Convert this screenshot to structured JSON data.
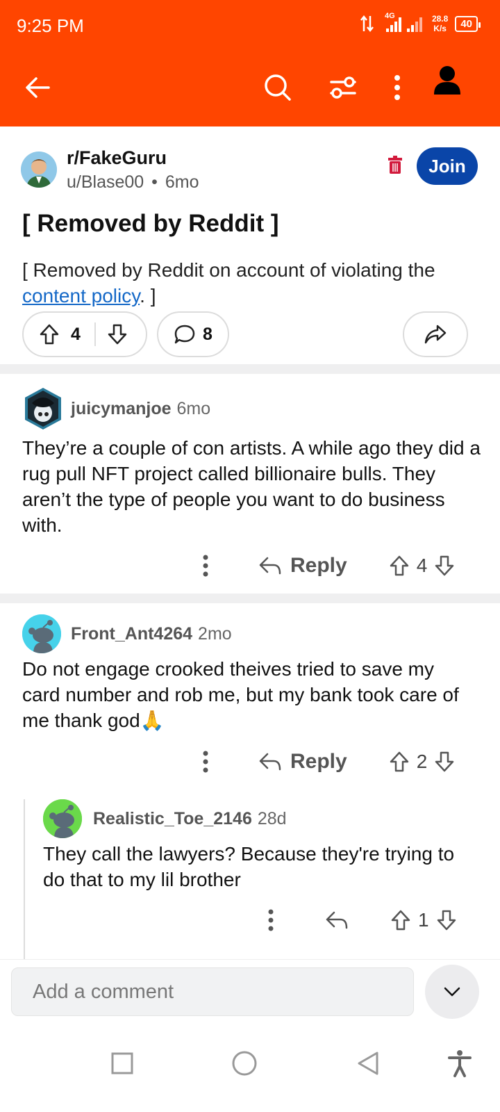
{
  "status_bar": {
    "time": "9:25 PM",
    "network": "4G",
    "speed_value": "28.8",
    "speed_unit": "K/s",
    "battery": "40"
  },
  "toolbar": {
    "back_icon": "arrow-left-icon",
    "search_icon": "search-icon",
    "filter_icon": "sliders-icon",
    "more_icon": "more-vertical-icon",
    "profile_icon": "person-icon"
  },
  "post": {
    "subreddit": "r/FakeGuru",
    "author": "u/Blase00",
    "separator": "•",
    "age": "6mo",
    "join_label": "Join",
    "title": "[ Removed by Reddit ]",
    "body_before": "[ Removed by Reddit on account of violating the ",
    "body_link": "content policy",
    "body_after": ". ]",
    "upvotes": "4",
    "comments": "8"
  },
  "comments": [
    {
      "author": "juicymanjoe",
      "age": "6mo",
      "text": "They’re a couple of con artists. A while ago they did a rug pull NFT project called billionaire bulls. They aren’t the type of people you want to do business with.",
      "reply_label": "Reply",
      "votes": "4"
    },
    {
      "author": "Front_Ant4264",
      "age": "2mo",
      "text": "Do not engage crooked theives tried to save my card number and rob me, but my bank took care of me thank god🙏",
      "reply_label": "Reply",
      "votes": "2"
    },
    {
      "author": "Realistic_Toe_2146",
      "age": "28d",
      "text": "They call the lawyers? Because they're trying to do that to my lil brother",
      "votes": "1"
    }
  ],
  "comment_bar": {
    "placeholder": "Add a comment"
  },
  "colors": {
    "brand": "#ff4500",
    "join": "#0a45a8",
    "link": "#1468c7"
  }
}
